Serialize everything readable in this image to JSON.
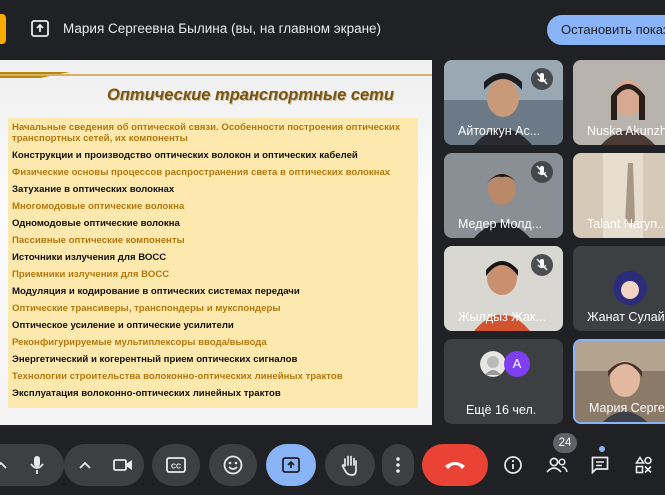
{
  "header": {
    "presenter_text": "Мария Сергеевна Былина (вы, на главном экране)",
    "stop_button": "Остановить показ"
  },
  "slide": {
    "title": "Оптические транспортные сети",
    "items": [
      {
        "text": "Начальные сведения об оптической связи. Особенности построения оптических транспортных сетей, их компоненты",
        "tone": "gold"
      },
      {
        "text": "Конструкции и производство оптических волокон и оптических кабелей",
        "tone": "black"
      },
      {
        "text": "Физические основы процессов распространения света в оптических волокнах",
        "tone": "gold"
      },
      {
        "text": "Затухание в оптических волокнах",
        "tone": "black"
      },
      {
        "text": "Многомодовые оптические волокна",
        "tone": "gold"
      },
      {
        "text": "Одномодовые оптические волокна",
        "tone": "black"
      },
      {
        "text": "Пассивные оптические компоненты",
        "tone": "gold"
      },
      {
        "text": "Источники излучения для ВОСС",
        "tone": "black"
      },
      {
        "text": "Приемники излучения для ВОСС",
        "tone": "gold"
      },
      {
        "text": "Модуляция и кодирование в оптических системах передачи",
        "tone": "black"
      },
      {
        "text": "Оптические трансиверы, транспондеры и мукспондеры",
        "tone": "gold"
      },
      {
        "text": "Оптическое усиление и оптические усилители",
        "tone": "black"
      },
      {
        "text": "Реконфигурируемые мультиплексоры ввода/вывода",
        "tone": "gold"
      },
      {
        "text": "Энергетический и когерентный прием оптических сигналов",
        "tone": "black"
      },
      {
        "text": "Технологии строительства волоконно-оптических линейных трактов",
        "tone": "gold"
      },
      {
        "text": "Эксплуатация волоконно-оптических линейных трактов",
        "tone": "black"
      }
    ]
  },
  "participants": [
    {
      "name": "Айтолкун Ас...",
      "muted": true
    },
    {
      "name": "Nuska Akunzh",
      "muted": false
    },
    {
      "name": "Медер Молд...",
      "muted": true
    },
    {
      "name": "Talant Naryn...",
      "muted": false
    },
    {
      "name": "Жылдыз Жак...",
      "muted": true
    },
    {
      "name": "Жанат Сулай...",
      "muted": false
    },
    {
      "name": "Мария Сергее...",
      "muted": false
    }
  ],
  "more": {
    "label": "Ещё 16 чел.",
    "avatar_letter": "A"
  },
  "controls": {
    "participants_count": "24",
    "icons": [
      "chevron-up-icon",
      "mic-icon",
      "chevron-up-icon",
      "camera-icon",
      "captions-icon",
      "emoji-icon",
      "present-icon",
      "raise-hand-icon",
      "more-vert-icon",
      "end-call-icon",
      "info-icon",
      "people-icon",
      "chat-icon",
      "activities-icon"
    ]
  },
  "colors": {
    "accent": "#8ab4f8",
    "end_call": "#ea4335",
    "bar": "#202124",
    "tile": "#3c4043"
  }
}
